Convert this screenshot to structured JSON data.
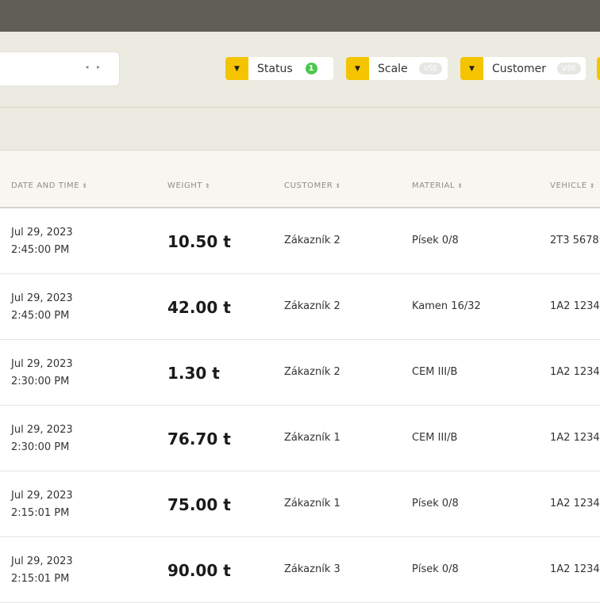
{
  "filters": {
    "date_range": {
      "arrows": "◂ ▸"
    },
    "status": {
      "label": "Status",
      "count": "1",
      "icon": "chevron-down-icon"
    },
    "scale": {
      "label": "Scale",
      "badge": "VŠE",
      "icon": "chevron-down-icon"
    },
    "customer": {
      "label": "Customer",
      "badge": "VŠE",
      "icon": "chevron-down-icon"
    }
  },
  "table": {
    "columns": [
      {
        "label": "DATE AND TIME",
        "sort": "⬍"
      },
      {
        "label": "WEIGHT",
        "sort": "⬍"
      },
      {
        "label": "CUSTOMER",
        "sort": "⬍"
      },
      {
        "label": "MATERIAL",
        "sort": "⬍"
      },
      {
        "label": "VEHICLE",
        "sort": "⬍"
      }
    ],
    "rows": [
      {
        "date": "Jul 29, 2023",
        "time": "2:45:00 PM",
        "weight": "10.50 t",
        "customer": "Zákazník 2",
        "material": "Písek 0/8",
        "vehicle": "2T3 5678"
      },
      {
        "date": "Jul 29, 2023",
        "time": "2:45:00 PM",
        "weight": "42.00 t",
        "customer": "Zákazník 2",
        "material": "Kamen 16/32",
        "vehicle": "1A2 1234"
      },
      {
        "date": "Jul 29, 2023",
        "time": "2:30:00 PM",
        "weight": "1.30 t",
        "customer": "Zákazník 2",
        "material": "CEM III/B",
        "vehicle": "1A2 1234"
      },
      {
        "date": "Jul 29, 2023",
        "time": "2:30:00 PM",
        "weight": "76.70 t",
        "customer": "Zákazník 1",
        "material": "CEM III/B",
        "vehicle": "1A2 1234"
      },
      {
        "date": "Jul 29, 2023",
        "time": "2:15:01 PM",
        "weight": "75.00 t",
        "customer": "Zákazník 1",
        "material": "Písek 0/8",
        "vehicle": "1A2 1234"
      },
      {
        "date": "Jul 29, 2023",
        "time": "2:15:01 PM",
        "weight": "90.00 t",
        "customer": "Zákazník 3",
        "material": "Písek 0/8",
        "vehicle": "1A2 1234"
      }
    ]
  },
  "colors": {
    "accent": "#f5c400",
    "topbar": "#5f5d56",
    "filterbar": "#ecebe1",
    "status_badge": "#4cc64f"
  }
}
